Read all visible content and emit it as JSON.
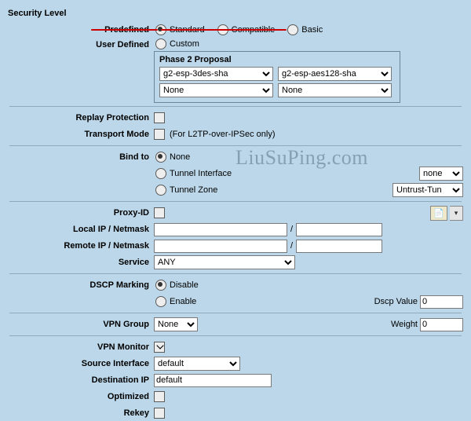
{
  "security_level": {
    "title": "Security Level",
    "predefined_label": "Predefined",
    "opts": {
      "standard": "Standard",
      "compatible": "Compatible",
      "basic": "Basic"
    },
    "user_defined_label": "User Defined",
    "custom": "Custom"
  },
  "phase2": {
    "title": "Phase 2 Proposal",
    "r1a": "g2-esp-3des-sha",
    "r1b": "g2-esp-aes128-sha",
    "r2a": "None",
    "r2b": "None"
  },
  "replay": {
    "label": "Replay Protection"
  },
  "transport": {
    "label": "Transport Mode",
    "note": "(For L2TP-over-IPSec only)"
  },
  "bind": {
    "label": "Bind to",
    "none": "None",
    "ti": "Tunnel Interface",
    "tz": "Tunnel Zone",
    "ti_sel": "none",
    "tz_sel": "Untrust-Tun"
  },
  "proxy": {
    "label": "Proxy-ID",
    "local": "Local IP / Netmask",
    "remote": "Remote IP / Netmask",
    "service": "Service",
    "service_sel": "ANY",
    "slash": "/",
    "local_ip": "",
    "local_mask": "",
    "remote_ip": "",
    "remote_mask": ""
  },
  "dscp": {
    "label": "DSCP Marking",
    "disable": "Disable",
    "enable": "Enable",
    "value_label": "Dscp Value",
    "value": "0"
  },
  "vpngroup": {
    "label": "VPN Group",
    "sel": "None",
    "weight_label": "Weight",
    "weight": "0"
  },
  "vpnmon": {
    "label": "VPN Monitor",
    "src": "Source Interface",
    "src_sel": "default",
    "dst": "Destination IP",
    "dst_val": "default",
    "opt": "Optimized",
    "rekey": "Rekey"
  },
  "watermark": "LiuSuPing.com"
}
